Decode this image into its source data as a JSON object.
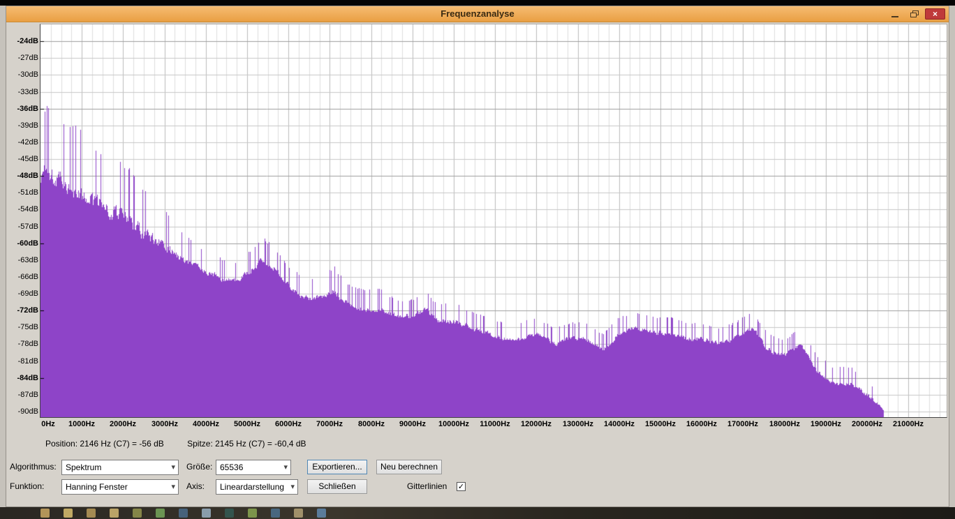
{
  "window": {
    "title": "Frequenzanalyse",
    "titlebar_icons": [
      "minimize",
      "restore",
      "close"
    ]
  },
  "icons": {
    "chevron_down": "▾",
    "check": "✓",
    "close": "×"
  },
  "axes": {
    "y_tick_labels": [
      "-24dB",
      "-27dB",
      "-30dB",
      "-33dB",
      "-36dB",
      "-39dB",
      "-42dB",
      "-45dB",
      "-48dB",
      "-51dB",
      "-54dB",
      "-57dB",
      "-60dB",
      "-63dB",
      "-66dB",
      "-69dB",
      "-72dB",
      "-75dB",
      "-78dB",
      "-81dB",
      "-84dB",
      "-87dB",
      "-90dB"
    ],
    "x_tick_labels": [
      "0Hz",
      "1000Hz",
      "2000Hz",
      "3000Hz",
      "4000Hz",
      "5000Hz",
      "6000Hz",
      "7000Hz",
      "8000Hz",
      "9000Hz",
      "10000Hz",
      "11000Hz",
      "12000Hz",
      "13000Hz",
      "14000Hz",
      "15000Hz",
      "16000Hz",
      "17000Hz",
      "18000Hz",
      "19000Hz",
      "20000Hz",
      "21000Hz"
    ]
  },
  "status": {
    "position": "Position: 2146 Hz (C7) = -56 dB",
    "peak": "Spitze: 2145 Hz (C7) = -60,4 dB"
  },
  "controls": {
    "algorithm": {
      "label": "Algorithmus:",
      "value": "Spektrum"
    },
    "size": {
      "label": "Größe:",
      "value": "65536"
    },
    "function": {
      "label": "Funktion:",
      "value": "Hanning Fenster"
    },
    "axis": {
      "label": "Axis:",
      "value": "Lineardarstellung"
    },
    "export_button": "Exportieren...",
    "recalculate_button": "Neu berechnen",
    "close_button": "Schließen",
    "gridlines": {
      "label": "Gitterlinien",
      "checked": true
    }
  },
  "chart_data": {
    "type": "area",
    "title": "Frequenzanalyse",
    "xlabel": "",
    "ylabel": "",
    "xlim": [
      0,
      21900
    ],
    "ylim": [
      -91,
      -21
    ],
    "x_tick_step_hz": 1000,
    "y_tick_step_db": 3,
    "grid": true,
    "legend": "none",
    "fill_color": "#8e44c8",
    "series": [
      {
        "name": "Spektrum",
        "x_hz": [
          0,
          150,
          300,
          500,
          700,
          900,
          1100,
          1300,
          1500,
          1700,
          1900,
          2100,
          2300,
          2500,
          2700,
          2900,
          3100,
          3300,
          3600,
          3900,
          4200,
          4500,
          4800,
          5100,
          5400,
          5700,
          6000,
          6400,
          6800,
          7100,
          7400,
          7800,
          8200,
          8600,
          9000,
          9300,
          9600,
          10000,
          10400,
          10800,
          11200,
          11600,
          12000,
          12400,
          12800,
          13200,
          13600,
          14000,
          14400,
          14800,
          15200,
          15600,
          16000,
          16400,
          16800,
          17200,
          17600,
          18000,
          18400,
          18800,
          19200,
          19600,
          20000,
          20400
        ],
        "peak_db": [
          -36,
          -35,
          -36,
          -37,
          -38,
          -39,
          -41,
          -42,
          -43,
          -44,
          -45,
          -46,
          -48,
          -50,
          -52,
          -53,
          -55,
          -57,
          -59,
          -61,
          -62,
          -63,
          -63,
          -61,
          -59,
          -61,
          -64,
          -66,
          -66,
          -64,
          -67,
          -68,
          -68,
          -70,
          -70,
          -68,
          -71,
          -70,
          -72,
          -73,
          -74,
          -74,
          -73,
          -75,
          -74,
          -74,
          -76,
          -73,
          -72,
          -73,
          -73,
          -74,
          -74,
          -75,
          -74,
          -72,
          -76,
          -77,
          -75,
          -80,
          -82,
          -82,
          -84,
          -89
        ],
        "valley_db": [
          -52,
          -50,
          -52,
          -53,
          -54,
          -55,
          -56,
          -57,
          -57,
          -58,
          -58,
          -59,
          -60,
          -61,
          -62,
          -62,
          -63,
          -64,
          -65,
          -66,
          -67,
          -68,
          -68,
          -66,
          -64,
          -66,
          -69,
          -71,
          -71,
          -70,
          -72,
          -73,
          -73,
          -74,
          -74,
          -73,
          -75,
          -75,
          -76,
          -77,
          -78,
          -78,
          -77,
          -79,
          -78,
          -78,
          -80,
          -77,
          -76,
          -77,
          -77,
          -78,
          -78,
          -79,
          -78,
          -76,
          -80,
          -81,
          -79,
          -84,
          -86,
          -86,
          -88,
          -90
        ]
      }
    ]
  },
  "desktop_strip": {
    "icon_colors": [
      "#b99a5d",
      "#c8b068",
      "#ab8f54",
      "#c2aa6a",
      "#8a8a4a",
      "#6f9a55",
      "#49657f",
      "#8fa3b2",
      "#35564f",
      "#7f9a4d",
      "#4a6a84",
      "#a5966e",
      "#5d81a0"
    ]
  }
}
